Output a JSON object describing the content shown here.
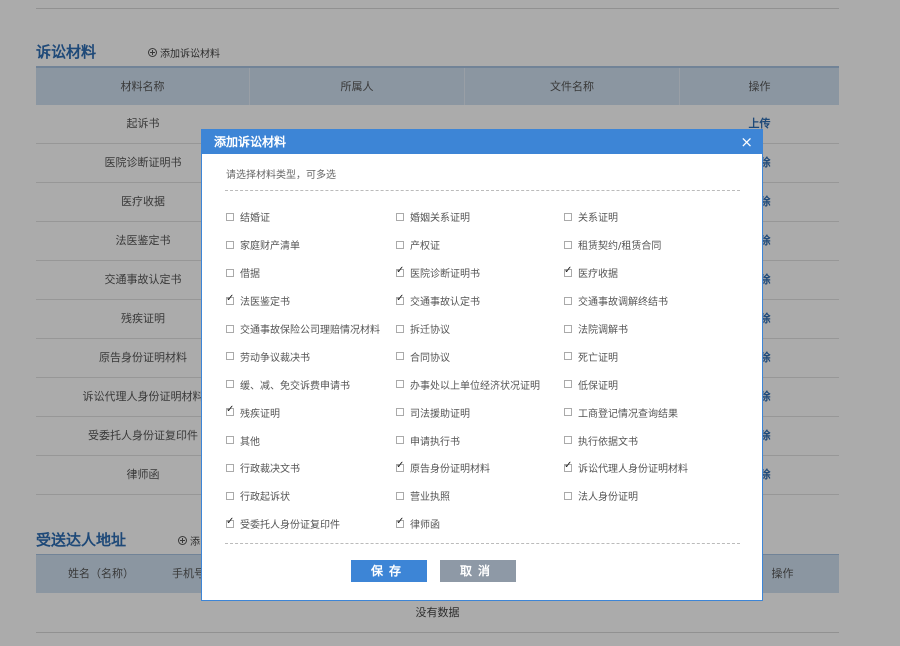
{
  "section1": {
    "title": "诉讼材料",
    "add_label": "添加诉讼材料",
    "columns": [
      "材料名称",
      "所属人",
      "文件名称",
      "操作"
    ],
    "rows": [
      {
        "name": "起诉书",
        "op": "上传"
      },
      {
        "name": "医院诊断证明书",
        "op": "删除"
      },
      {
        "name": "医疗收据",
        "op": "删除"
      },
      {
        "name": "法医鉴定书",
        "op": "删除"
      },
      {
        "name": "交通事故认定书",
        "op": "删除"
      },
      {
        "name": "残疾证明",
        "op": "删除"
      },
      {
        "name": "原告身份证明材料",
        "op": "删除"
      },
      {
        "name": "诉讼代理人身份证明材料",
        "op": "删除"
      },
      {
        "name": "受委托人身份证复印件",
        "op": "删除"
      },
      {
        "name": "律师函",
        "op": "删除"
      }
    ]
  },
  "section2": {
    "title": "受送达人地址",
    "add_label": "添",
    "columns": [
      "姓名（名称）",
      "手机号",
      "操作"
    ],
    "empty_text": "没有数据"
  },
  "modal": {
    "title": "添加诉讼材料",
    "close": "×",
    "hint": "请选择材料类型，可多选",
    "save_label": "保存",
    "cancel_label": "取消",
    "options": [
      {
        "label": "结婚证",
        "checked": false
      },
      {
        "label": "婚姻关系证明",
        "checked": false
      },
      {
        "label": "关系证明",
        "checked": false
      },
      {
        "label": "家庭财产清单",
        "checked": false
      },
      {
        "label": "产权证",
        "checked": false
      },
      {
        "label": "租赁契约/租赁合同",
        "checked": false
      },
      {
        "label": "借据",
        "checked": false
      },
      {
        "label": "医院诊断证明书",
        "checked": true
      },
      {
        "label": "医疗收据",
        "checked": true
      },
      {
        "label": "法医鉴定书",
        "checked": true
      },
      {
        "label": "交通事故认定书",
        "checked": true
      },
      {
        "label": "交通事故调解终结书",
        "checked": false
      },
      {
        "label": "交通事故保险公司理赔情况材料",
        "checked": false
      },
      {
        "label": "拆迁协议",
        "checked": false
      },
      {
        "label": "法院调解书",
        "checked": false
      },
      {
        "label": "劳动争议裁决书",
        "checked": false
      },
      {
        "label": "合同协议",
        "checked": false
      },
      {
        "label": "死亡证明",
        "checked": false
      },
      {
        "label": "缓、减、免交诉费申请书",
        "checked": false
      },
      {
        "label": "办事处以上单位经济状况证明",
        "checked": false
      },
      {
        "label": "低保证明",
        "checked": false
      },
      {
        "label": "残疾证明",
        "checked": true
      },
      {
        "label": "司法援助证明",
        "checked": false
      },
      {
        "label": "工商登记情况查询结果",
        "checked": false
      },
      {
        "label": "其他",
        "checked": false
      },
      {
        "label": "申请执行书",
        "checked": false
      },
      {
        "label": "执行依据文书",
        "checked": false
      },
      {
        "label": "行政裁决文书",
        "checked": false
      },
      {
        "label": "原告身份证明材料",
        "checked": true
      },
      {
        "label": "诉讼代理人身份证明材料",
        "checked": true
      },
      {
        "label": "行政起诉状",
        "checked": false
      },
      {
        "label": "营业执照",
        "checked": false
      },
      {
        "label": "法人身份证明",
        "checked": false
      },
      {
        "label": "受委托人身份证复印件",
        "checked": true
      },
      {
        "label": "律师函",
        "checked": true
      }
    ]
  }
}
